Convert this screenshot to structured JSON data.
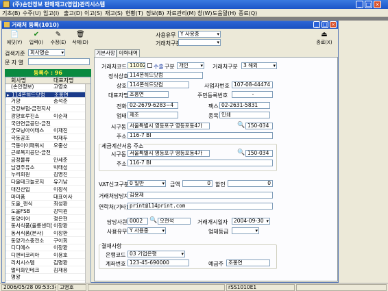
{
  "app_title": "(주)손안정보 판매재고(영업)관리시스템",
  "menu": [
    "기초(B)",
    "수주(U)",
    "입고(I)",
    "출고(D)",
    "이고(S)",
    "재고(S)",
    "현황(T)",
    "정보(B)",
    "자료관리(M)",
    "창(W)",
    "도움말(H)",
    "종료(Q)"
  ],
  "child_title": "거래처 등록(1010)",
  "toolbar": {
    "new": "에딧(Y)",
    "input": "입력(I)",
    "edit": "수정(E)",
    "delete": "삭제(D)",
    "close": "종료(X)"
  },
  "top_filter": {
    "use_label": "사용유무",
    "use_value": "Y 사용중",
    "type_label": "거래처구분"
  },
  "left": {
    "search_label": "검색기준",
    "search_value": "회사명순",
    "text_label": "문 자 열",
    "count": "등록수 : 96",
    "col1": "회사명",
    "col2": "대표자명",
    "rows": [
      {
        "name": "(손안정보)",
        "rep": "고영호"
      },
      {
        "name": "114폰히드닷컴",
        "rep": "조홍연"
      },
      {
        "name": "거양",
        "rep": "송석준"
      },
      {
        "name": "건강보험-금천지사",
        "rep": ""
      },
      {
        "name": "광양호루진소",
        "rep": "이순재"
      },
      {
        "name": "국민연금공단-금천",
        "rep": ""
      },
      {
        "name": "굿모닝아이테스",
        "rep": "이재진"
      },
      {
        "name": "극동공조",
        "rep": "박재두"
      },
      {
        "name": "극동이이패워시",
        "rep": "오중산"
      },
      {
        "name": "근로복지공단-금천",
        "rep": ""
      },
      {
        "name": "금정물류",
        "rep": "안세준"
      },
      {
        "name": "남경주유소",
        "rep": "박태성"
      },
      {
        "name": "누리회원",
        "rep": "김영진"
      },
      {
        "name": "다올테크놀로지",
        "rep": "유기남"
      },
      {
        "name": "대진산업",
        "rep": "이창석"
      },
      {
        "name": "마미폼",
        "rep": "대표이사"
      },
      {
        "name": "도울_캔식",
        "rep": "최성환"
      },
      {
        "name": "도울FSB",
        "rep": "강덕원"
      },
      {
        "name": "동양이어",
        "rep": "정은현"
      },
      {
        "name": "동서식품(울릉센터)",
        "rep": "이창환"
      },
      {
        "name": "동서식품(본사)",
        "rep": "이창환"
      },
      {
        "name": "동양가스충전소",
        "rep": "구이회"
      },
      {
        "name": "디디에스",
        "rep": "이창환"
      },
      {
        "name": "디엔비코리아",
        "rep": "이용호"
      },
      {
        "name": "리치시스템",
        "rep": "김명환"
      },
      {
        "name": "멀티화인테크",
        "rep": "김재용"
      },
      {
        "name": "명왕",
        "rep": ""
      }
    ]
  },
  "tabs": [
    "기본사항",
    "이력내역"
  ],
  "form": {
    "code_label": "거래처코드",
    "code_value": "11002",
    "category_check": "수출",
    "division_label": "구분",
    "division_value": "개인",
    "type_label": "거래처구분",
    "type_value": "3 해외",
    "official_name_label": "정식상호",
    "official_name_value": "114폰히드닷컴",
    "name_label": "상호",
    "name_value": "114폰히드닷컴",
    "bizno_label": "사업자번호",
    "bizno_value": "107-08-44474",
    "rep_label": "대표자명",
    "rep_value": "조홍연",
    "resident_label": "주민등록번호",
    "resident_value": "-",
    "phone_label": "전화",
    "phone_value": "02-2679-6283~4",
    "fax_label": "팩스",
    "fax_value": "02-2631-5831",
    "biztype_label": "업태",
    "biztype_value": "제조",
    "item_label": "종목",
    "item_value": "인쇄",
    "addr1_label": "시구동",
    "addr1_value": "서울특별시 영등포구 영등포동4가",
    "zip1_value": "150-034",
    "addr2_label": "주소",
    "addr2_value": "116-7 BI",
    "tax_group_label": "세금계산서용 주소",
    "tax_addr1_label": "시구동",
    "tax_addr1_value": "서울특별시 영등포구 영등포동4가",
    "tax_zip_value": "150-034",
    "tax_addr2_label": "주소",
    "tax_addr2_value": "116-7 BI",
    "vat_label": "VAT신고구분",
    "vat_value": "0 일반",
    "amount_label": "금액",
    "amount_value": "0",
    "discount_label": "할인",
    "discount_value": "0",
    "contact_label": "거래처담당자",
    "contact_value": "김용재",
    "contact_other_label": "연락처(기타)",
    "contact_other_value": "print@114print.com",
    "sales_label": "담당사원",
    "sales_code": "0002",
    "sales_name": "오현석",
    "start_date_label": "거래개시일자",
    "start_date_value": "2004-09-30",
    "use_label": "사용유무",
    "use_value": "Y 사용중",
    "grade_label": "업체등급",
    "payment_group_label": "결재사항",
    "bank_label": "은행코드",
    "bank_value": "03 기업은행",
    "account_label": "계좌번호",
    "account_value": "123-45-690000",
    "holder_label": "예금주",
    "holder_value": "조홍연"
  },
  "status": {
    "datetime": "2006/05/28 09:53:34 오후",
    "user": "고영호",
    "screen": "rSS1010E1"
  }
}
